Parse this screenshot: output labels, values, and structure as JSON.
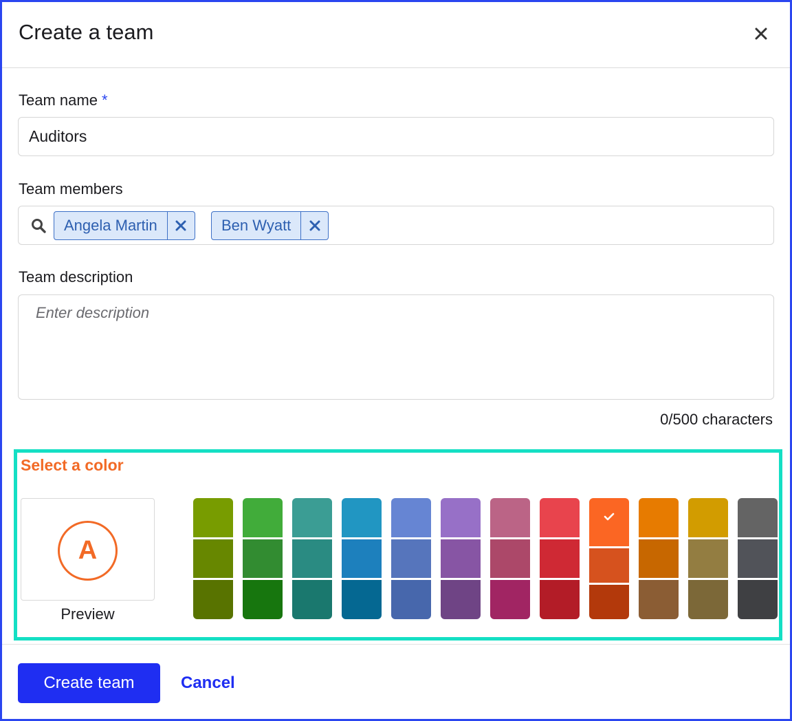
{
  "dialog": {
    "title": "Create a team"
  },
  "team_name": {
    "label": "Team name",
    "required_mark": "*",
    "value": "Auditors"
  },
  "team_members": {
    "label": "Team members",
    "chips": [
      {
        "label": "Angela Martin"
      },
      {
        "label": "Ben Wyatt"
      }
    ]
  },
  "team_description": {
    "label": "Team description",
    "placeholder": "Enter description",
    "counter": "0/500 characters"
  },
  "color_picker": {
    "title": "Select a color",
    "preview_letter": "A",
    "preview_label": "Preview",
    "selected_color": "#f26a26",
    "swatches": [
      [
        "#789c00",
        "#678700",
        "#587300"
      ],
      [
        "#41ac3a",
        "#328c31",
        "#17760e"
      ],
      [
        "#3b9d94",
        "#2a8b82",
        "#1a786e"
      ],
      [
        "#2196c2",
        "#1d80bd",
        "#056892"
      ],
      [
        "#6685d3",
        "#5675bc",
        "#4767ac"
      ],
      [
        "#9770c7",
        "#8755a4",
        "#6f4485"
      ],
      [
        "#bb6486",
        "#ac4869",
        "#a12563"
      ],
      [
        "#e8444d",
        "#cf2934",
        "#b31c27"
      ],
      [
        "#fb6623",
        "#d6521e",
        "#b3390b"
      ],
      [
        "#e77b00",
        "#c76700",
        "#8b5d34"
      ],
      [
        "#d29c00",
        "#937d41",
        "#7c6838"
      ],
      [
        "#646464",
        "#515359",
        "#3f4043"
      ]
    ]
  },
  "footer": {
    "primary_label": "Create team",
    "cancel_label": "Cancel"
  }
}
